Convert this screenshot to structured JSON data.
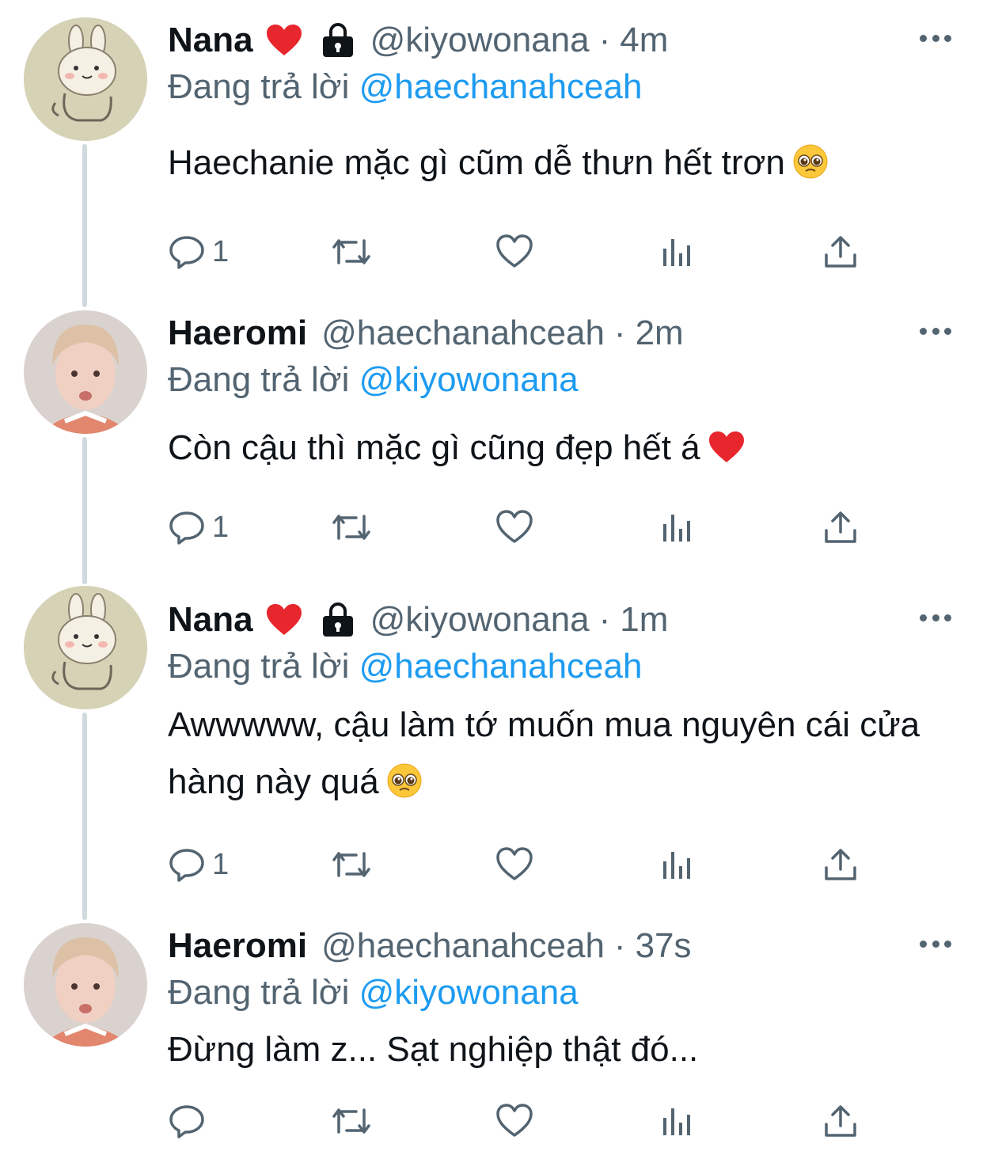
{
  "tweets": [
    {
      "name": "Nana",
      "handle": "@kiyowonana",
      "sep": "·",
      "time": "4m",
      "replying_prefix": "Đang trả lời",
      "replying_to": "@haechanahceah",
      "text": "Haechanie mặc gì cũm dễ thưn hết trơn",
      "reply_count": "1",
      "avatar": "bunny-avatar",
      "protected": true,
      "name_emoji": "red-heart-emoji",
      "text_emoji": "pleading-face-emoji"
    },
    {
      "name": "Haeromi",
      "handle": "@haechanahceah",
      "sep": "·",
      "time": "2m",
      "replying_prefix": "Đang trả lời",
      "replying_to": "@kiyowonana",
      "text": "Còn cậu thì mặc gì cũng đẹp hết á",
      "reply_count": "1",
      "avatar": "person-avatar",
      "protected": false,
      "text_emoji": "red-heart-emoji"
    },
    {
      "name": "Nana",
      "handle": "@kiyowonana",
      "sep": "·",
      "time": "1m",
      "replying_prefix": "Đang trả lời",
      "replying_to": "@haechanahceah",
      "text": "Awwwww, cậu làm tớ muốn mua nguyên cái cửa hàng này quá",
      "reply_count": "1",
      "avatar": "bunny-avatar",
      "protected": true,
      "name_emoji": "red-heart-emoji",
      "text_emoji": "pleading-face-emoji"
    },
    {
      "name": "Haeromi",
      "handle": "@haechanahceah",
      "sep": "·",
      "time": "37s",
      "replying_prefix": "Đang trả lời",
      "replying_to": "@kiyowonana",
      "text": "Đừng làm z... Sạt nghiệp thật đó...",
      "reply_count": "",
      "avatar": "person-avatar",
      "protected": false
    }
  ],
  "colors": {
    "text": "#0f1419",
    "secondary": "#536471",
    "link": "#1d9bf0",
    "thread_line": "#cfd9de"
  }
}
